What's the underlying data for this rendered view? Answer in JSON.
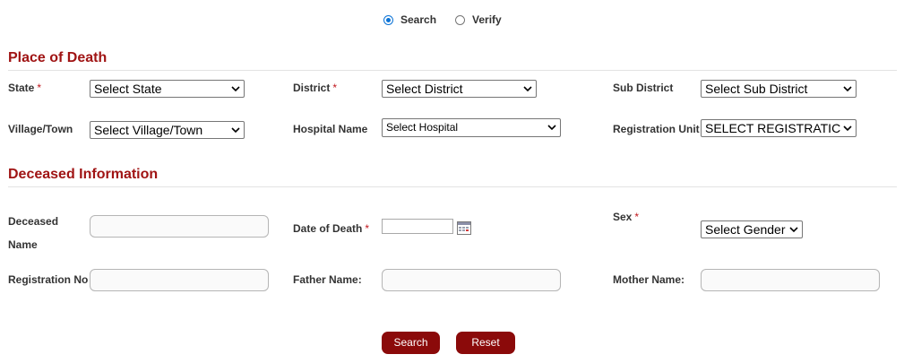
{
  "mode": {
    "options": [
      {
        "label": "Search",
        "checked": true
      },
      {
        "label": "Verify",
        "checked": false
      }
    ]
  },
  "place_of_death": {
    "title": "Place of Death",
    "state": {
      "label": "State",
      "value": "Select State"
    },
    "district": {
      "label": "District",
      "value": "Select District"
    },
    "sub_district": {
      "label": "Sub District",
      "value": "Select Sub District"
    },
    "village": {
      "label": "Village/Town",
      "value": "Select Village/Town"
    },
    "hospital": {
      "label": "Hospital Name",
      "value": "Select Hospital"
    },
    "reg_unit": {
      "label": "Registration Unit",
      "value": "SELECT REGISTRATIC"
    }
  },
  "deceased": {
    "title": "Deceased Information",
    "name_label_line1": "Deceased",
    "name_label_line2": "Name",
    "name_value": "",
    "dod_label": "Date of Death",
    "dod_value": "",
    "sex_label": "Sex",
    "sex_value": "Select Gender",
    "reg_no_label": "Registration No",
    "reg_no_value": "",
    "father_label": "Father Name:",
    "father_value": "",
    "mother_label": "Mother Name:",
    "mother_value": ""
  },
  "required_marker": "*",
  "actions": {
    "search_label": "Search",
    "reset_label": "Reset"
  },
  "colors": {
    "section_title": "#a01414",
    "button_bg": "#8b0a0a",
    "required": "#c0161c",
    "radio_accent": "#0b73d6"
  }
}
